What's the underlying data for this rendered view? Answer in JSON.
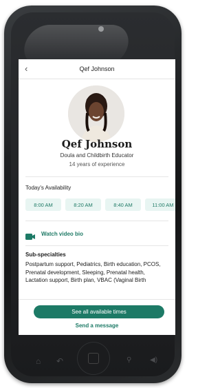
{
  "header": {
    "back_icon": "chevron-left-icon",
    "title": "Qef Johnson"
  },
  "profile": {
    "name": "Qef Johnson",
    "role": "Doula and Childbirth Educator",
    "experience": "14 years of experience"
  },
  "availability": {
    "title": "Today's Availability",
    "slots": [
      "8:00 AM",
      "8:20 AM",
      "8:40 AM",
      "11:00 AM"
    ]
  },
  "video": {
    "icon": "video-camera-icon",
    "label": "Watch video bio"
  },
  "subspecialties": {
    "title": "Sub-specialties",
    "text": "Postpartum support, Pediatrics, Birth education, PCOS, Prenatal development, Sleeping, Prenatal health, Lactation support, Birth plan, VBAC (Vaginal Birth"
  },
  "actions": {
    "see_all": "See all available times",
    "send_message": "Send a message"
  },
  "colors": {
    "accent": "#1d7a66",
    "slot_bg": "#e8f5f2"
  }
}
